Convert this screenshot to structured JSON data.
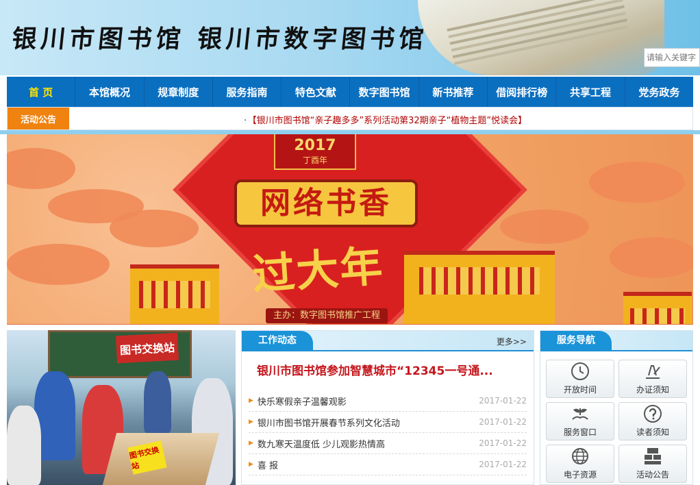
{
  "header": {
    "logo_text": "银川市图书馆 银川市数字图书馆",
    "search_placeholder": "请输入关键字"
  },
  "nav": {
    "items": [
      "首 页",
      "本馆概况",
      "规章制度",
      "服务指南",
      "特色文献",
      "数字图书馆",
      "新书推荐",
      "借阅排行榜",
      "共享工程",
      "党务政务"
    ]
  },
  "notice": {
    "tag": "活动公告",
    "bullet": "·",
    "message": "【银川市图书馆“亲子趣多多”系列活动第32期亲子“植物主题”悦读会】"
  },
  "banner": {
    "year": "2017",
    "year_sub": "丁酉年",
    "title": "网络书香",
    "subtitle": "过大年",
    "host": "主办：数字图书馆推广工程"
  },
  "photo": {
    "sign_text": "图书交换站",
    "sign_small": "图书交换站"
  },
  "news": {
    "title": "工作动态",
    "more": "更多>>",
    "headline": "银川市图书馆参加智慧城市“12345一号通...",
    "items": [
      {
        "title": "快乐寒假亲子温馨观影",
        "date": "2017-01-22"
      },
      {
        "title": "银川市图书馆开展春节系列文化活动",
        "date": "2017-01-22"
      },
      {
        "title": "数九寒天温度低 少儿观影热情高",
        "date": "2017-01-22"
      },
      {
        "title": "喜 报",
        "date": "2017-01-22"
      }
    ]
  },
  "service": {
    "title": "服务导航",
    "items": [
      {
        "label": "开放时间",
        "icon": "clock-icon"
      },
      {
        "label": "办证须知",
        "icon": "pen-icon"
      },
      {
        "label": "服务窗口",
        "icon": "hands-icon"
      },
      {
        "label": "读者须知",
        "icon": "question-icon"
      },
      {
        "label": "电子资源",
        "icon": "globe-icon"
      },
      {
        "label": "活动公告",
        "icon": "best-icon"
      }
    ]
  },
  "colors": {
    "nav": "#0b6fc0",
    "nav_active": "#ffe400",
    "accent_orange": "#f0820f",
    "headline_red": "#c4161c",
    "panel_blue": "#1a93d8"
  }
}
